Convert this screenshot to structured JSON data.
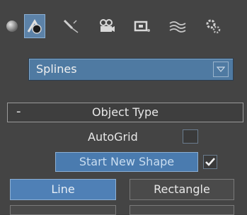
{
  "toolbar": {
    "icons": [
      "geometry-icon",
      "shapes-icon",
      "lights-icon",
      "cameras-icon",
      "helpers-icon",
      "space-warps-icon",
      "systems-icon"
    ],
    "active": "shapes-icon"
  },
  "category_dropdown": {
    "value": "Splines"
  },
  "object_type_rollout": {
    "collapse_symbol": "-",
    "title": "Object Type",
    "autogrid_label": "AutoGrid",
    "autogrid_checked": false,
    "start_new_shape_label": "Start New Shape",
    "start_new_shape_checked": true,
    "buttons": [
      {
        "label": "Line",
        "active": true
      },
      {
        "label": "Rectangle",
        "active": false
      }
    ]
  }
}
